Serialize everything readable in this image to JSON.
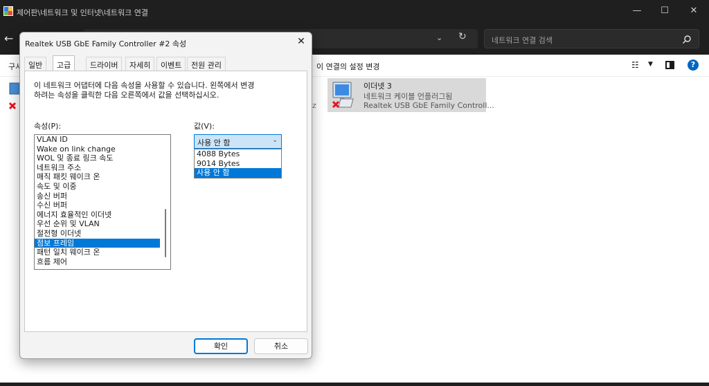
{
  "explorer": {
    "title": "제어판\\네트워크 및 인터넷\\네트워크 연결",
    "search_placeholder": "네트워크 연결 검색",
    "cmd_organize": "구서",
    "cmd_change_settings": "이 연결의 설정 변경",
    "peek_text": "z",
    "item": {
      "name": "이더넷 3",
      "status": "네트워크 케이블 언플러그됨",
      "device": "Realtek USB GbE Family Controll..."
    },
    "icons": [
      "app-icon",
      "back-arrow-icon",
      "chevron-down-icon",
      "refresh-icon",
      "search-icon",
      "view-options-icon",
      "details-pane-icon",
      "help-icon",
      "network-adapter-icon",
      "disconnected-x-icon"
    ]
  },
  "dialog": {
    "title": "Realtek USB GbE Family Controller #2 속성",
    "close": "✕",
    "tabs": [
      "일반",
      "고급",
      "드라이버",
      "자세히",
      "이벤트",
      "전원 관리"
    ],
    "active_tab": "고급",
    "description": [
      "이 네트워크 어댑터에 다음 속성을 사용할 수 있습니다. 왼쪽에서 변경",
      "하려는 속성을 클릭한 다음 오른쪽에서 값을 선택하십시오."
    ],
    "property_label": "속성(P):",
    "value_label": "값(V):",
    "properties": [
      "VLAN ID",
      "Wake on link change",
      "WOL 및 종료 링크 속도",
      "네트워크 주소",
      "매직 패킷 웨이크 온",
      "속도 및 이중",
      "송신 버퍼",
      "수신 버퍼",
      "에너지 효율적인 이더넷",
      "우선 순위 및 VLAN",
      "절전형 이더넷",
      "점보 프레임",
      "패턴 일치 웨이크 온",
      "흐름 제어"
    ],
    "selected_property": "점보 프레임",
    "value_current": "사용 안 함",
    "value_options": [
      "4088 Bytes",
      "9014 Bytes",
      "사용 안 함"
    ],
    "ok_label": "확인",
    "cancel_label": "취소"
  },
  "colors": {
    "accent": "#0078d7",
    "titlebar_bg": "#1f1f1f",
    "dialog_bg": "#f3f3f3",
    "selected_item_bg": "#d9d9d9",
    "error_red": "#e81123"
  }
}
